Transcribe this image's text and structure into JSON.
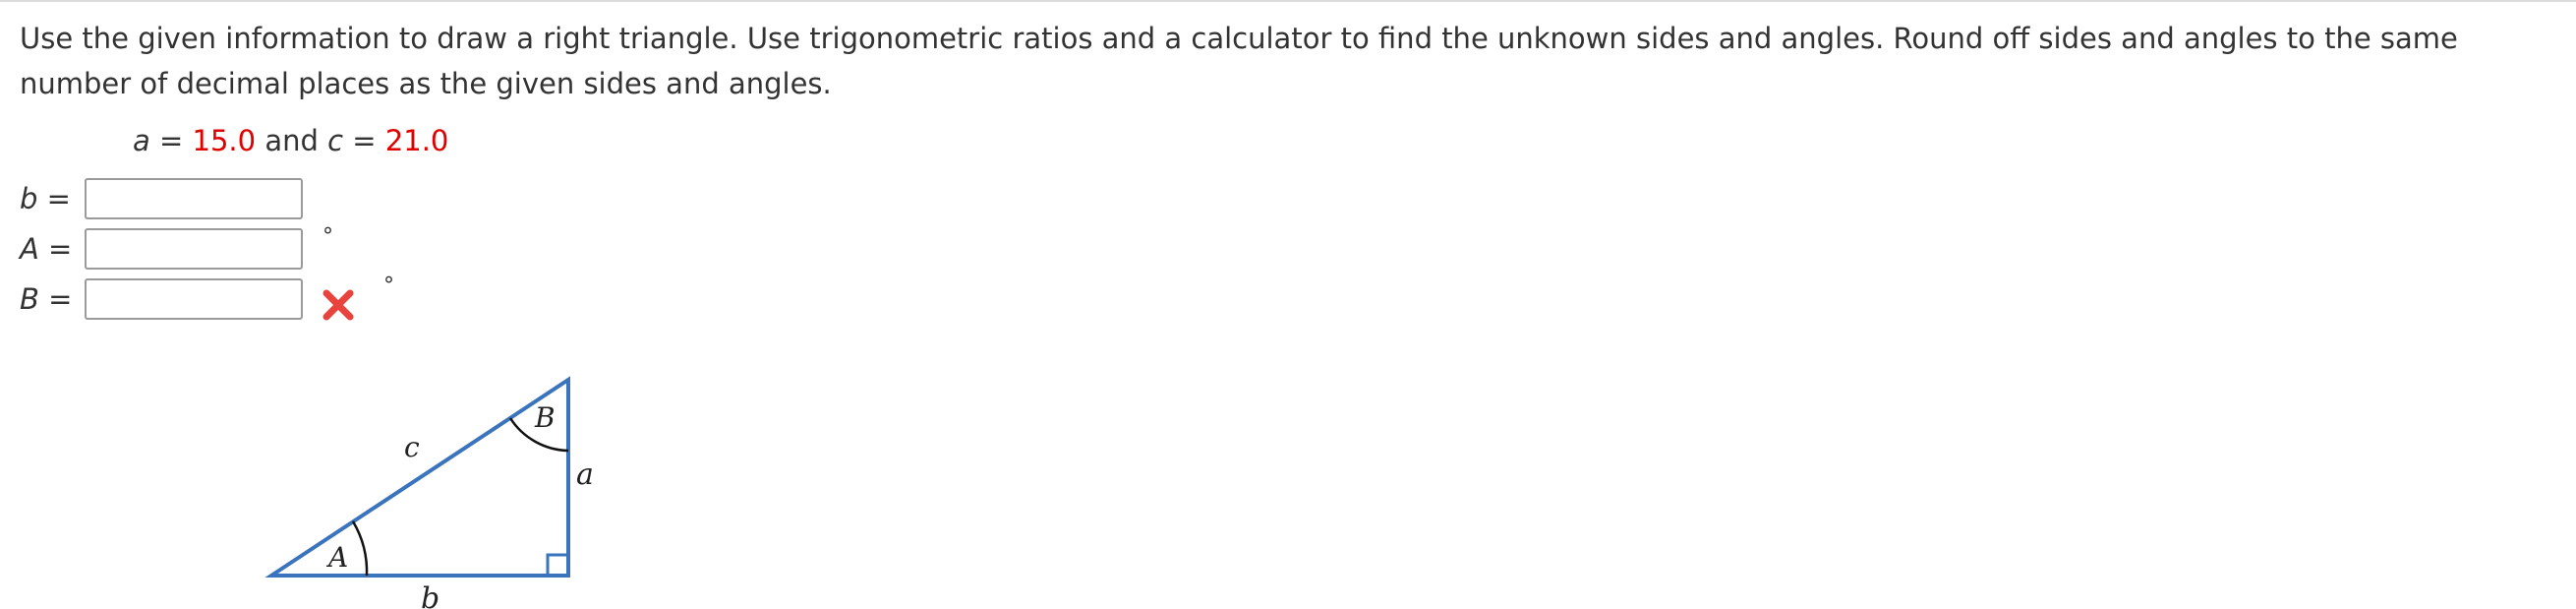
{
  "question": {
    "text": "Use the given information to draw a right triangle. Use trigonometric ratios and a calculator to find the unknown sides and angles. Round off sides and angles to the same number of decimal places as the given sides and angles."
  },
  "given": {
    "a_var": "a",
    "eq1": " = ",
    "a_value": "15.0",
    "and": " and ",
    "c_var": "c",
    "eq2": " = ",
    "c_value": "21.0"
  },
  "answers": {
    "b": {
      "var": "b",
      "eq": " =",
      "value": ""
    },
    "A": {
      "var": "A",
      "eq": " =",
      "value": "",
      "unit": "°"
    },
    "B": {
      "var": "B",
      "eq": " =",
      "value": "",
      "unit": "°"
    }
  },
  "feedback": {
    "status": "incorrect",
    "icon": "x-mark-icon",
    "color": "#e8433d"
  },
  "triangle": {
    "labels": {
      "c": "c",
      "a": "a",
      "b": "b",
      "A": "A",
      "B": "B"
    },
    "stroke_color": "#3a74bd"
  }
}
